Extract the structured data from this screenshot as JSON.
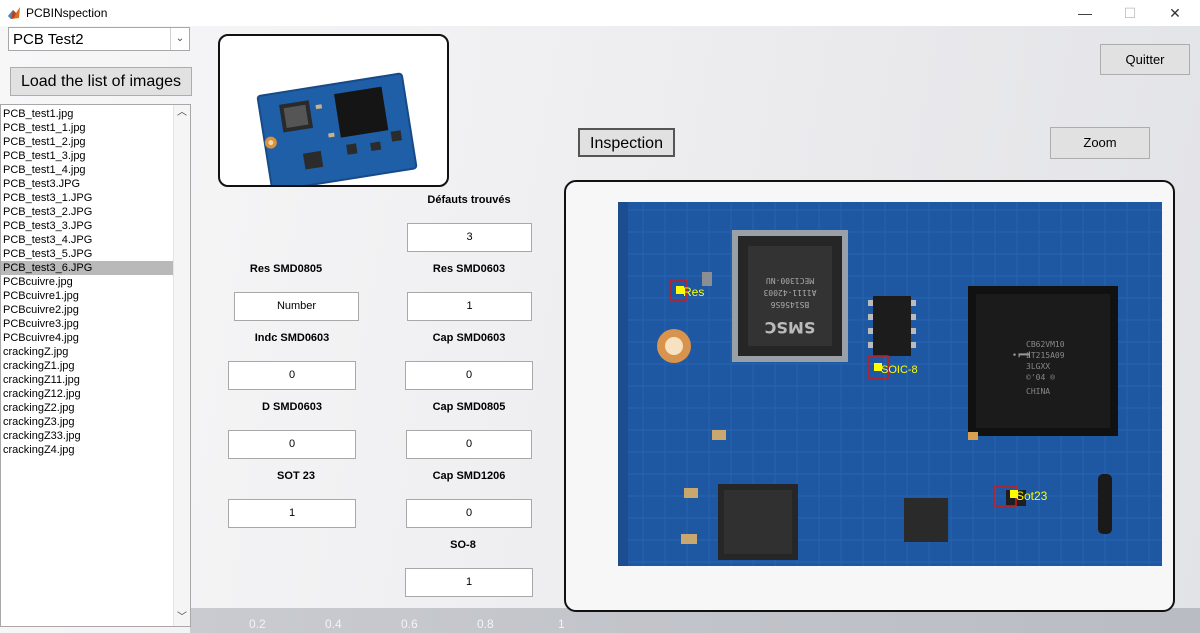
{
  "window": {
    "title": "PCBINspection",
    "minimize_glyph": "—",
    "maximize_glyph": "☐",
    "close_glyph": "✕"
  },
  "dropdown": {
    "value": "PCB Test2",
    "arrow_glyph": "⌄"
  },
  "buttons": {
    "load": "Load the list of images",
    "inspection": "Inspection",
    "quit": "Quitter",
    "zoom": "Zoom"
  },
  "image_list": {
    "items": [
      "PCB_test1.jpg",
      "PCB_test1_1.jpg",
      "PCB_test1_2.jpg",
      "PCB_test1_3.jpg",
      "PCB_test1_4.jpg",
      "PCB_test3.JPG",
      "PCB_test3_1.JPG",
      "PCB_test3_2.JPG",
      "PCB_test3_3.JPG",
      "PCB_test3_4.JPG",
      "PCB_test3_5.JPG",
      "PCB_test3_6.JPG",
      "PCBcuivre.jpg",
      "PCBcuivre1.jpg",
      "PCBcuivre2.jpg",
      "PCBcuivre3.jpg",
      "PCBcuivre4.jpg",
      "crackingZ.jpg",
      "crackingZ1.jpg",
      "crackingZ11.jpg",
      "crackingZ12.jpg",
      "crackingZ2.jpg",
      "crackingZ3.jpg",
      "crackingZ33.jpg",
      "crackingZ4.jpg"
    ],
    "selected_index": 11,
    "scroll_up_glyph": "︿",
    "scroll_down_glyph": "﹀"
  },
  "fields": {
    "defauts_label": "Défauts trouvés",
    "defauts_value": "3",
    "res0805_label": "Res SMD0805",
    "res0805_value": "Number",
    "res0603_label": "Res SMD0603",
    "res0603_value": "1",
    "indc0603_label": "Indc SMD0603",
    "indc0603_value": "0",
    "cap0603_label": "Cap SMD0603",
    "cap0603_value": "0",
    "d0603_label": "D SMD0603",
    "d0603_value": "0",
    "cap0805_label": "Cap SMD0805",
    "cap0805_value": "0",
    "sot23_label": "SOT 23",
    "sot23_value": "1",
    "cap1206_label": "Cap SMD1206",
    "cap1206_value": "0",
    "so8_label": "SO-8",
    "so8_value": "1"
  },
  "inspection_image": {
    "marker_labels": [
      "Res",
      "SOIC-8",
      "Sot23"
    ],
    "chip_text": {
      "smsc_lines": [
        "MEC1300-NU",
        "A1111-42003",
        "BS1456S6"
      ],
      "smsc_logo": "SMSC",
      "intel_lines": [
        "CB62VM10",
        "LT215A09",
        "3LGXX",
        "©'04 ®",
        "CHINA"
      ],
      "intel_logo": "i"
    }
  },
  "axis_ticks": [
    "0.2",
    "0.4",
    "0.6",
    "0.8",
    "1"
  ],
  "colors": {
    "board": "#1f5aa8",
    "marker_box": "#d21818",
    "marker_fill": "#ffff00",
    "selected_row": "#b9b9b9"
  }
}
